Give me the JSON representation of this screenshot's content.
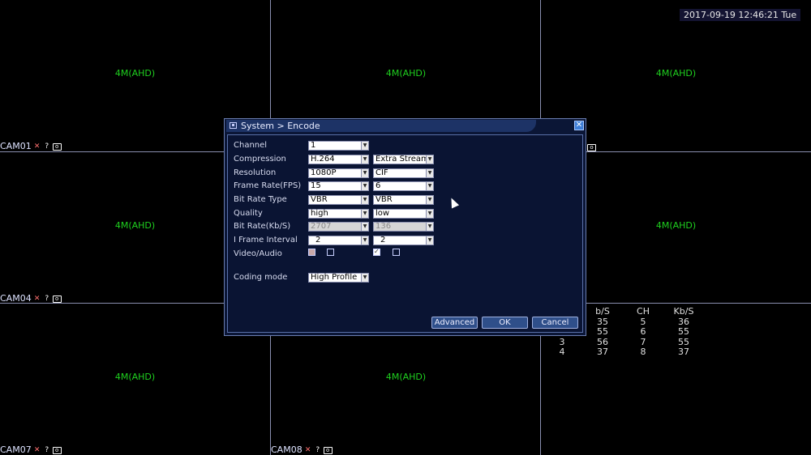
{
  "datetime": "2017-09-19 12:46:21 Tue",
  "tiles": [
    {
      "res": "4M(AHD)",
      "cam": "CAM01"
    },
    {
      "res": "4M(AHD)",
      "cam": ""
    },
    {
      "res": "4M(AHD)",
      "cam": ""
    },
    {
      "res": "4M(AHD)",
      "cam": "CAM04"
    },
    {
      "res": "",
      "cam": ""
    },
    {
      "res": "4M(AHD)",
      "cam": ""
    },
    {
      "res": "4M(AHD)",
      "cam": "CAM07"
    },
    {
      "res": "4M(AHD)",
      "cam": "CAM08"
    },
    {
      "res": "",
      "cam": ""
    }
  ],
  "stats": {
    "headers": [
      "",
      "b/S",
      "CH",
      "Kb/S"
    ],
    "rows": [
      [
        "",
        "35",
        "5",
        "36"
      ],
      [
        "",
        "55",
        "6",
        "55"
      ],
      [
        "3",
        "56",
        "7",
        "55"
      ],
      [
        "4",
        "37",
        "8",
        "37"
      ]
    ]
  },
  "dialog": {
    "title": "System > Encode",
    "close_icon": "close-icon",
    "fields": {
      "channel": {
        "label": "Channel",
        "value": "1"
      },
      "compression": {
        "label": "Compression",
        "main": "H.264",
        "extra": "Extra Stream"
      },
      "resolution": {
        "label": "Resolution",
        "main": "1080P",
        "extra": "CIF"
      },
      "fps": {
        "label": "Frame Rate(FPS)",
        "main": "15",
        "extra": "6"
      },
      "bitrate_type": {
        "label": "Bit Rate Type",
        "main": "VBR",
        "extra": "VBR"
      },
      "quality": {
        "label": "Quality",
        "main": "high",
        "extra": "low"
      },
      "bitrate": {
        "label": "Bit Rate(Kb/S)",
        "main": "2707",
        "extra": "136"
      },
      "iframe": {
        "label": "I Frame Interval",
        "main": "2",
        "extra": "2"
      },
      "video_audio": {
        "label": "Video/Audio"
      },
      "coding_mode": {
        "label": "Coding mode",
        "value": "High Profile"
      }
    },
    "buttons": {
      "advanced": "Advanced",
      "ok": "OK",
      "cancel": "Cancel"
    }
  }
}
